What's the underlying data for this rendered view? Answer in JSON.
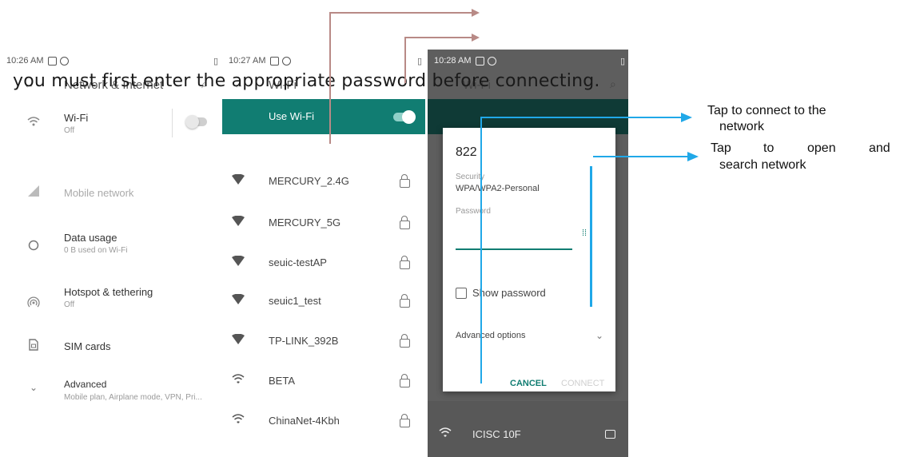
{
  "overlay_text": "you must first enter the appropriate password before connecting.",
  "callouts": {
    "connect_line1": "Tap  to  connect  to the",
    "connect_line2": "network",
    "open_line1_a": "Tap",
    "open_line1_b": "to",
    "open_line1_c": "open",
    "open_line1_d": "and",
    "open_line2": "search  network"
  },
  "panel1": {
    "time": "10:26 AM",
    "title": "Network & Internet",
    "items": [
      {
        "title": "Wi-Fi",
        "subtitle": "Off",
        "icon": "wifi-icon"
      },
      {
        "title": "Mobile network",
        "subtitle": "",
        "icon": "signal-icon"
      },
      {
        "title": "Data usage",
        "subtitle": "0 B used on Wi-Fi",
        "icon": "data-usage-icon"
      },
      {
        "title": "Hotspot & tethering",
        "subtitle": "Off",
        "icon": "hotspot-icon"
      },
      {
        "title": "SIM cards",
        "subtitle": "",
        "icon": "sim-icon"
      },
      {
        "title": "Advanced",
        "subtitle": "Mobile plan, Airplane mode, VPN, Pri...",
        "icon": "chevron-down-icon"
      }
    ]
  },
  "panel2": {
    "time": "10:27 AM",
    "title": "Wi-Fi",
    "use_wifi": "Use Wi-Fi",
    "networks": [
      "MERCURY_2.4G",
      "MERCURY_5G",
      "seuic-testAP",
      "seuic1_test",
      "TP-LINK_392B",
      "BETA",
      "ChinaNet-4Kbh"
    ]
  },
  "panel3": {
    "time": "10:28 AM",
    "title": "Wi-Fi",
    "dialog": {
      "ssid": "822",
      "security_label": "Security",
      "security_value": "WPA/WPA2-Personal",
      "password_label": "Password",
      "show_password": "Show password",
      "advanced": "Advanced options",
      "cancel": "CANCEL",
      "connect": "CONNECT"
    },
    "bottom_network": "ICISC 10F"
  }
}
